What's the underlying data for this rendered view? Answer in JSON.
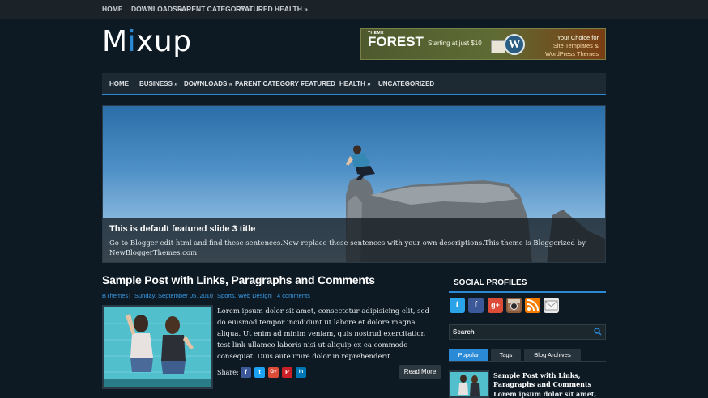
{
  "topnav": {
    "items": [
      "HOME",
      "DOWNLOADS »",
      "PARENT CATEGORY »",
      "FEATURED",
      "HEALTH »"
    ]
  },
  "logo": {
    "prefix": "M",
    "i": "i",
    "rest": "xup"
  },
  "ad": {
    "brand_small": "THEME",
    "brand": "FOREST",
    "price": "Starting at just $10",
    "tagline1": "Your Choice for",
    "tagline2": "Site Templates &",
    "tagline3": "WordPress Themes",
    "wp_letter": "W"
  },
  "mainnav": {
    "items": [
      "HOME",
      "BUSINESS »",
      "DOWNLOADS »",
      "PARENT CATEGORY »",
      "FEATURED",
      "HEALTH »",
      "UNCATEGORIZED"
    ]
  },
  "slider": {
    "title": "This is default featured slide 3 title",
    "description": "Go to Blogger edit html and find these sentences.Now replace these sentences with your own descriptions.This theme is Bloggerized by NewBloggerThemes.com."
  },
  "post": {
    "title": "Sample Post with Links, Paragraphs and Comments",
    "author": "BThemes",
    "date": "Sunday, September 05, 2010",
    "labels": "Sports, Web Design",
    "comments": "4 comments",
    "excerpt": "Lorem ipsum dolor sit amet, consectetur adipisicing elit, sed do eiusmod tempor incididunt ut labore et dolore magna aliqua. Ut enim ad minim veniam, quis nostrud exercitation test link ullamco laboris nisi ut aliquip ex ea commodo consequat. Duis aute irure dolor in reprehenderit…",
    "share_label": "Share:",
    "share_buttons": [
      "f",
      "t",
      "G+",
      "P",
      "in"
    ],
    "read_more": "Read More"
  },
  "sidebar": {
    "social_heading": "SOCIAL PROFILES",
    "social_icons": [
      "twitter-icon",
      "facebook-icon",
      "google-plus-icon",
      "instagram-icon",
      "rss-icon",
      "email-icon"
    ],
    "search_label": "Search",
    "tabs": [
      "Popular",
      "Tags",
      "Blog Archives"
    ],
    "popular_title": "Sample Post with Links, Paragraphs and Comments",
    "popular_excerpt": "Lorem ipsum dolor sit amet,"
  },
  "colors": {
    "accent": "#2a8ad6",
    "background": "#0d1a24",
    "topbar": "#1c2328"
  }
}
